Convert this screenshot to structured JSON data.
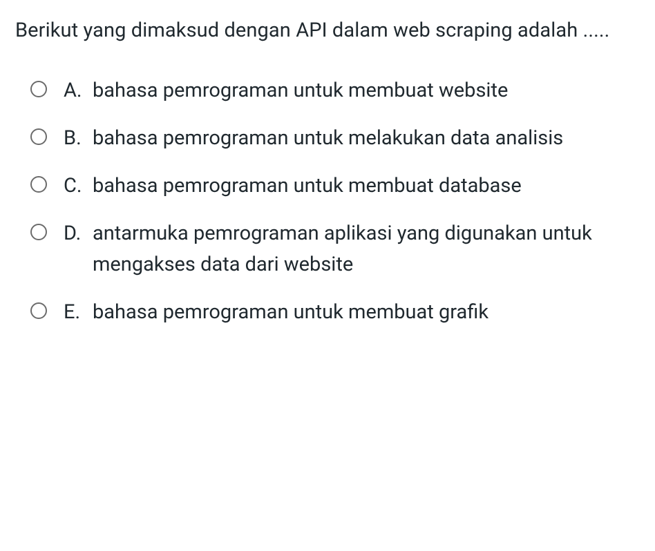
{
  "question": "Berikut yang dimaksud dengan API dalam web scraping adalah .....",
  "options": [
    {
      "letter": "A.",
      "text": "bahasa pemrograman untuk membuat website"
    },
    {
      "letter": "B.",
      "text": "bahasa pemrograman untuk melakukan data analisis"
    },
    {
      "letter": "C.",
      "text": "bahasa pemrograman untuk membuat database"
    },
    {
      "letter": "D.",
      "text": "antarmuka pemrograman aplikasi yang digunakan untuk mengakses data dari website"
    },
    {
      "letter": "E.",
      "text": "bahasa pemrograman untuk membuat grafik"
    }
  ]
}
